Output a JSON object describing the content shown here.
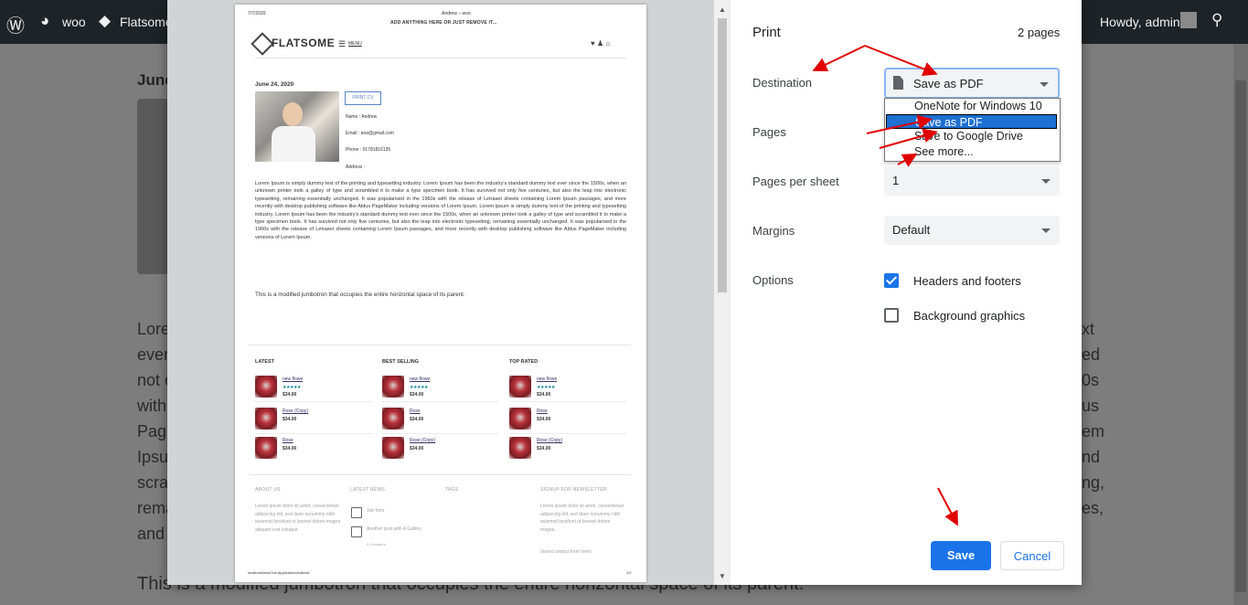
{
  "admin_bar": {
    "site_name": "woo",
    "theme_name": "Flatsome",
    "greeting": "Howdy, admin"
  },
  "background_page": {
    "date": "June",
    "lorem_lines": [
      "Lore",
      "ever",
      "not c",
      "with",
      "Page",
      "Ipsu",
      "scra",
      "rema",
      "and"
    ],
    "right_fragments": [
      "xt",
      "ed",
      "0s",
      "us",
      "em",
      "nd",
      "ng,",
      "es,"
    ],
    "bottom_text": "This is a modified jumbotron that occupies the entire horizontal space of its parent."
  },
  "preview": {
    "header_date": "7/7/2020",
    "header_title": "Andrew – woo",
    "banner": "ADD ANYTHING HERE OR JUST REMOVE IT...",
    "logo_text": "FLATSOME",
    "menu_label": "MENU",
    "post_date": "June 24, 2020",
    "print_cv": "PRINT CV",
    "name": "Name : Andrew",
    "email": "Email : ana@gmail.com",
    "phone": "Phone : 01781816135",
    "address": "Address :",
    "lorem": "Lorem Ipsum is simply dummy text of the printing and typesetting industry. Lorem Ipsum has been the industry's standard dummy text ever since the 1500s, when an unknown printer took a galley of type and scrambled it to make a type specimen book. It has survived not only five centuries, but also the leap into electronic typesetting, remaining essentially unchanged. It was popularised in the 1960s with the release of Letraset sheets containing Lorem Ipsum passages, and more recently with desktop publishing software like Aldus PageMaker including versions of Lorem Ipsum. Lorem Ipsum is simply dummy text of the printing and typesetting industry. Lorem Ipsum has been the industry's standard dummy text ever since the 1500s, when an unknown printer took a galley of type and scrambled it to make a type specimen book. It has survived not only five centuries, but also the leap into electronic typesetting, remaining essentially unchanged. It was popularised in the 1960s with the release of Letraset sheets containing Lorem Ipsum passages, and more recently with desktop publishing software like Aldus PageMaker including versions of Lorem Ipsum.",
    "jumbotron": "This is a modified jumbotron that occupies the entire horizontal space of its parent.",
    "columns": [
      {
        "title": "LATEST",
        "items": [
          {
            "name": "new flowe",
            "stars": "★★★★★",
            "price": "$34.00"
          },
          {
            "name": "Rose (Copy)",
            "stars": "",
            "price": "$34.00"
          },
          {
            "name": "Rose",
            "stars": "",
            "price": "$34.00"
          }
        ]
      },
      {
        "title": "BEST SELLING",
        "items": [
          {
            "name": "new flowe",
            "stars": "★★★★★",
            "price": "$34.00"
          },
          {
            "name": "Rose",
            "stars": "",
            "price": "$34.00"
          },
          {
            "name": "Rose (Copy)",
            "stars": "",
            "price": "$34.00"
          }
        ]
      },
      {
        "title": "TOP RATED",
        "items": [
          {
            "name": "new flowe",
            "stars": "★★★★★",
            "price": "$34.00"
          },
          {
            "name": "Rose",
            "stars": "",
            "price": "$34.00"
          },
          {
            "name": "Rose (Copy)",
            "stars": "",
            "price": "$34.00"
          }
        ]
      }
    ],
    "footer": {
      "about_title": "ABOUT US",
      "about_text": "Lorem ipsum dolor sit amet, consectetuer adipiscing elit, sed diam nonummy nibh euismod tincidunt ut laoreet dolore magna aliquam erat volutpat.",
      "news_title": "LATEST NEWS",
      "news_1": "Job form",
      "news_2": "Another post with A Gallery",
      "news_2_meta": "0 Comment",
      "tags_title": "TAGS",
      "newsletter_title": "SIGNUP FOR NEWSLETTER",
      "newsletter_text": "Lorem ipsum dolor sit amet, consectetuer adipiscing elit, sed diam nonummy nibh euismod tincidunt ut laoreet dolore magna.",
      "newsletter_form": "(insert contact form here)"
    },
    "footer_url": "localhost/woo/Job Application/andrew/",
    "page_number": "1/2"
  },
  "print": {
    "title": "Print",
    "page_count": "2 pages",
    "destination_label": "Destination",
    "destination_value": "Save as PDF",
    "destination_options": [
      "OneNote for Windows 10",
      "Save as PDF",
      "Save to Google Drive",
      "See more..."
    ],
    "selected_option_index": 1,
    "pages_label": "Pages",
    "pages_per_sheet_label": "Pages per sheet",
    "pages_per_sheet_value": "1",
    "margins_label": "Margins",
    "margins_value": "Default",
    "options_label": "Options",
    "headers_footers_label": "Headers and footers",
    "headers_footers_checked": true,
    "background_graphics_label": "Background graphics",
    "background_graphics_checked": false,
    "save_label": "Save",
    "cancel_label": "Cancel"
  },
  "colors": {
    "primary_blue": "#1a73e8",
    "annotation_red": "#e00000",
    "selected_option": "#1e70d2"
  }
}
